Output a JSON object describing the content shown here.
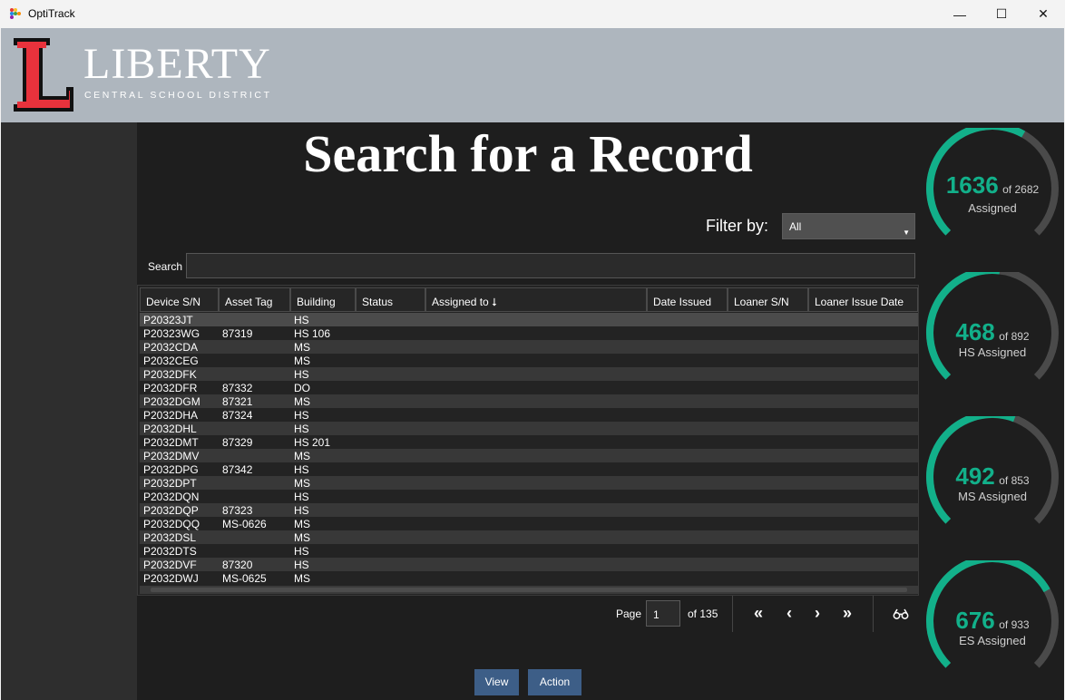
{
  "window": {
    "title": "OptiTrack",
    "minimize_glyph": "—",
    "maximize_glyph": "☐",
    "close_glyph": "✕"
  },
  "header": {
    "logo_letter": "L",
    "logo_word": "LIBERTY",
    "logo_sub": "CENTRAL SCHOOL DISTRICT"
  },
  "page": {
    "title": "Search for a Record"
  },
  "filter": {
    "label": "Filter by:",
    "value": "All",
    "arrow": "⌄"
  },
  "search": {
    "label": "Search",
    "value": "",
    "placeholder": ""
  },
  "table": {
    "columns": [
      "Device S/N",
      "Asset Tag",
      "Building",
      "Status",
      "Assigned to ⭣",
      "Date Issued",
      "Loaner S/N",
      "Loaner Issue Date"
    ],
    "rows": [
      [
        "P20323JT",
        "",
        "HS"
      ],
      [
        "P20323WG",
        "87319",
        "HS 106"
      ],
      [
        "P2032CDA",
        "",
        "MS"
      ],
      [
        "P2032CEG",
        "",
        "MS"
      ],
      [
        "P2032DFK",
        "",
        "HS"
      ],
      [
        "P2032DFR",
        "87332",
        "DO"
      ],
      [
        "P2032DGM",
        "87321",
        "MS"
      ],
      [
        "P2032DHA",
        "87324",
        "HS"
      ],
      [
        "P2032DHL",
        "",
        "HS"
      ],
      [
        "P2032DMT",
        "87329",
        "HS 201"
      ],
      [
        "P2032DMV",
        "",
        "MS"
      ],
      [
        "P2032DPG",
        "87342",
        "HS"
      ],
      [
        "P2032DPT",
        "",
        "MS"
      ],
      [
        "P2032DQN",
        "",
        "HS"
      ],
      [
        "P2032DQP",
        "87323",
        "HS"
      ],
      [
        "P2032DQQ",
        "MS-0626",
        "MS"
      ],
      [
        "P2032DSL",
        "",
        "MS"
      ],
      [
        "P2032DTS",
        "",
        "HS"
      ],
      [
        "P2032DVF",
        "87320",
        "HS"
      ],
      [
        "P2032DWJ",
        "MS-0625",
        "MS"
      ]
    ]
  },
  "pagination": {
    "label": "Page",
    "current": "1",
    "of_label": "of 135",
    "first": "«",
    "prev": "‹",
    "next": "›",
    "last": "»",
    "view_icon": "glasses-icon"
  },
  "actions": {
    "view": "View",
    "action": "Action"
  },
  "gauges": [
    {
      "assigned": 1636,
      "total": 2682,
      "num": "1636",
      "of": "of 2682",
      "label": "Assigned"
    },
    {
      "assigned": 468,
      "total": 892,
      "num": "468",
      "of": "of 892",
      "label": "HS Assigned"
    },
    {
      "assigned": 492,
      "total": 853,
      "num": "492",
      "of": "of 853",
      "label": "MS Assigned"
    },
    {
      "assigned": 676,
      "total": 933,
      "num": "676",
      "of": "of 933",
      "label": "ES Assigned"
    }
  ],
  "colors": {
    "accent": "#12b08a",
    "track": "#4a4a4a",
    "logo_red": "#e8323c",
    "button": "#3d5e87"
  }
}
